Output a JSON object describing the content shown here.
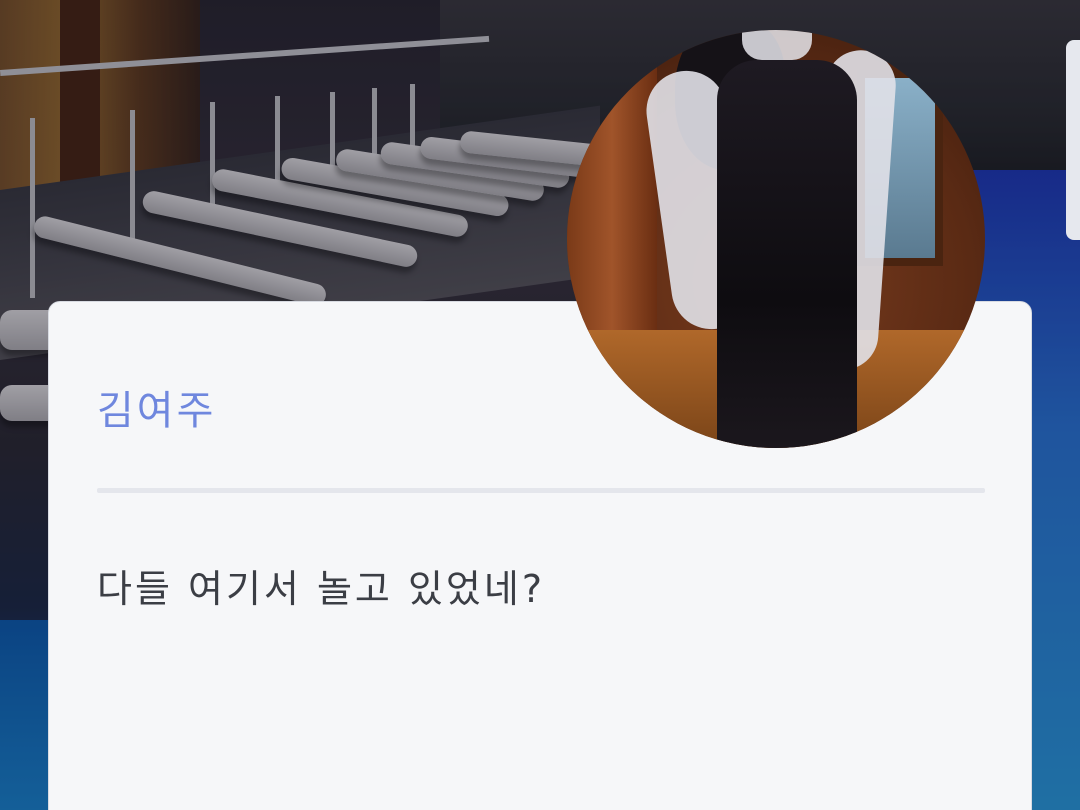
{
  "dialog": {
    "speaker_name": "김여주",
    "line": "다들 여기서 놀고 있었네?"
  },
  "colors": {
    "speaker_name": "#6f87de",
    "dialogue_text": "#3b3e45",
    "card_background": "#f6f7f9",
    "divider": "#e4e6ec"
  }
}
